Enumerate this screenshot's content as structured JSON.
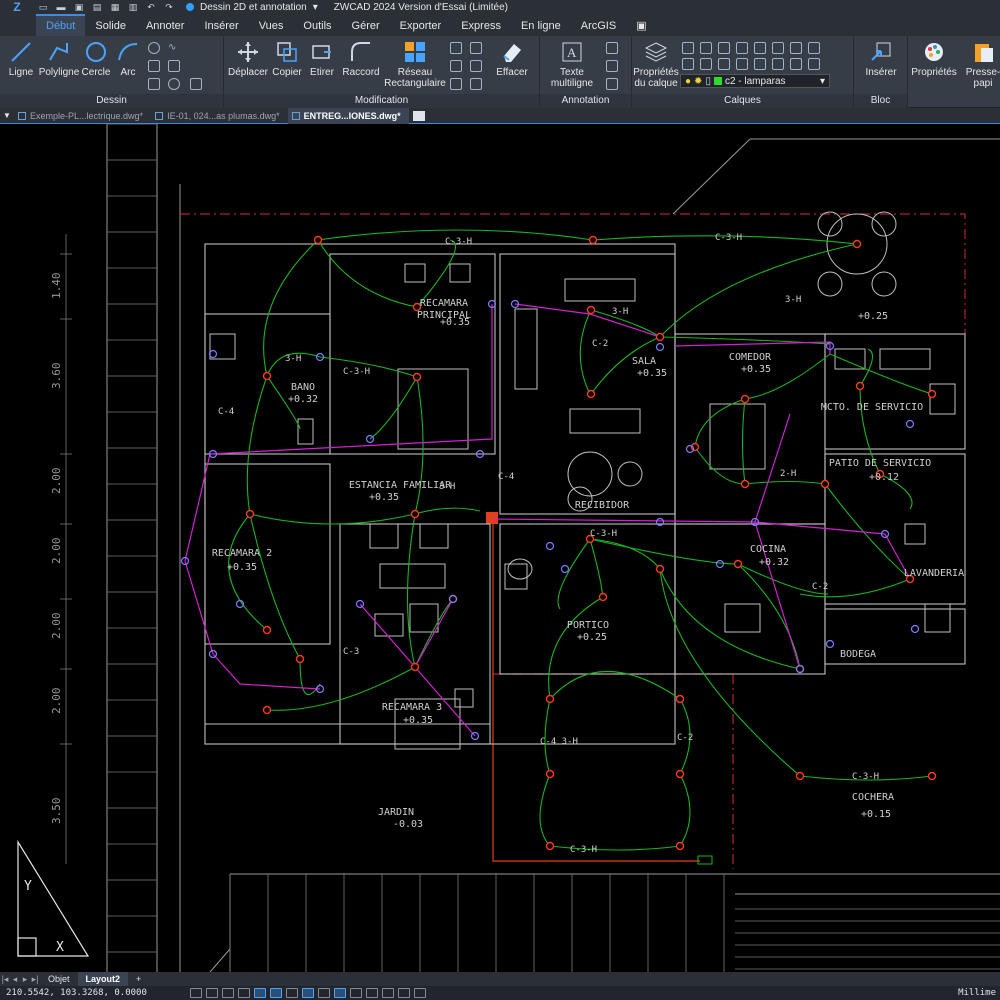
{
  "app": {
    "workspace": "Dessin 2D et annotation",
    "title": "ZWCAD 2024 Version d'Essai (Limitée)"
  },
  "ribbon_tabs": [
    "Début",
    "Solide",
    "Annoter",
    "Insérer",
    "Vues",
    "Outils",
    "Gérer",
    "Exporter",
    "Express",
    "En ligne",
    "ArcGIS"
  ],
  "panels": {
    "dessin": {
      "title": "Dessin",
      "tools": [
        "Ligne",
        "Polyligne",
        "Cercle",
        "Arc"
      ]
    },
    "modification": {
      "title": "Modification",
      "tools": [
        "Déplacer",
        "Copier",
        "Etirer",
        "Raccord",
        "Réseau\nRectangulaire",
        "Effacer"
      ]
    },
    "annotation": {
      "title": "Annotation",
      "tools": [
        "Texte\nmultiligne"
      ]
    },
    "calques": {
      "title": "Calques",
      "props_label": "Propriétés\ndu calque",
      "current_layer": "c2 - lamparas"
    },
    "bloc": {
      "title": "Bloc",
      "tools": [
        "Insérer"
      ]
    },
    "extra": {
      "tools": [
        "Propriétés",
        "Presse-papi"
      ]
    }
  },
  "doc_tabs": [
    "Exemple-PL...lectrique.dwg*",
    "IE-01, 024...as plumas.dwg*",
    "ENTREG...IONES.dwg*"
  ],
  "layout_tabs": [
    "Objet",
    "Layout2",
    "+"
  ],
  "status": {
    "coords": "210.5542, 103.3268, 0.0000",
    "units": "Millime"
  },
  "drawing": {
    "dimensions": [
      "1.40",
      "3.60",
      "2.00",
      "2.00",
      "2.00",
      "2.00",
      "3.50"
    ],
    "rooms": [
      {
        "name": "RECAMARA",
        "level": "PRINCIPAL"
      },
      {
        "name": "BANO",
        "level": "+0.32"
      },
      {
        "name": "SALA",
        "level": "+0.35"
      },
      {
        "name": "COMEDOR",
        "level": "+0.35"
      },
      {
        "name": "MCTO. DE SERVICIO",
        "level": ""
      },
      {
        "name": "ESTANCIA FAMILIAR",
        "level": "+0.35"
      },
      {
        "name": "PATIO DE SERVICIO",
        "level": "+0.12"
      },
      {
        "name": "RECIBIDOR",
        "level": ""
      },
      {
        "name": "RECAMARA 2",
        "level": "+0.35"
      },
      {
        "name": "COCINA",
        "level": "+0.32"
      },
      {
        "name": "LAVANDERIA",
        "level": ""
      },
      {
        "name": "PORTICO",
        "level": "+0.25"
      },
      {
        "name": "BODEGA",
        "level": ""
      },
      {
        "name": "RECAMARA 3",
        "level": "+0.35"
      },
      {
        "name": "JARDIN",
        "level": "-0.03"
      },
      {
        "name": "COCHERA",
        "level": "+0.15"
      }
    ],
    "extra_levels": [
      "+0.35",
      "+0.25"
    ],
    "circuit_labels": [
      "C-3-H",
      "C-4",
      "3-H",
      "2-H",
      "C-2",
      "C-3",
      "C-4 3-H",
      "C-3-H"
    ],
    "colors": {
      "wire": "#17b51f",
      "feeder": "#d21fd2",
      "outlet": "#ff3a1a",
      "wall": "#bfbfbf",
      "border": "#b0203a"
    }
  }
}
